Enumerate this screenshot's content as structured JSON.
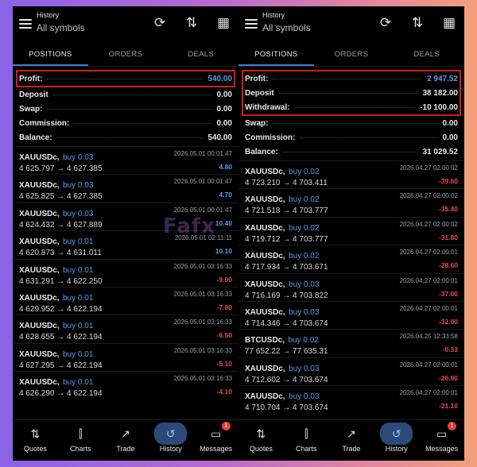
{
  "left": {
    "header": {
      "small": "History",
      "main": "All symbols"
    },
    "tabs": [
      "POSITIONS",
      "ORDERS",
      "DEALS"
    ],
    "summary": [
      {
        "label": "Profit:",
        "value": "540.00",
        "highlight": true,
        "blue": true
      },
      {
        "label": "Deposit",
        "value": "0.00"
      },
      {
        "label": "Swap:",
        "value": "0.00"
      },
      {
        "label": "Commission:",
        "value": "0.00"
      },
      {
        "label": "Balance:",
        "value": "540.00"
      }
    ],
    "deals": [
      {
        "symbol": "XAUUSDc,",
        "side": "buy 0.03",
        "time": "2026.05.01 00:01:47",
        "prices": "4 625.797 → 4 627.385",
        "profit": "4.80",
        "dir": "pos"
      },
      {
        "symbol": "XAUUSDc,",
        "side": "buy 0.03",
        "time": "2026.05.01 00:01:47",
        "prices": "4 625.825 → 4 627.385",
        "profit": "4.70",
        "dir": "pos"
      },
      {
        "symbol": "XAUUSDc,",
        "side": "buy 0.03",
        "time": "2026.05.01 00:01:47",
        "prices": "4 624.432 → 4 627.889",
        "profit": "10.40",
        "dir": "pos"
      },
      {
        "symbol": "XAUUSDc,",
        "side": "buy 0.01",
        "time": "2026.05.01 02:11:11",
        "prices": "4 620.873 → 4 631.011",
        "profit": "10.10",
        "dir": "pos"
      },
      {
        "symbol": "XAUUSDc,",
        "side": "buy 0.01",
        "time": "2026.05.01 03:16:33",
        "prices": "4 631.291 → 4 622.250",
        "profit": "-9.00",
        "dir": "neg"
      },
      {
        "symbol": "XAUUSDc,",
        "side": "buy 0.01",
        "time": "2026.05.01 03:16:33",
        "prices": "4 629.952 → 4 622.194",
        "profit": "-7.80",
        "dir": "neg"
      },
      {
        "symbol": "XAUUSDc,",
        "side": "buy 0.01",
        "time": "2026.05.01 03:16:33",
        "prices": "4 628.655 → 4 622.194",
        "profit": "-6.50",
        "dir": "neg"
      },
      {
        "symbol": "XAUUSDc,",
        "side": "buy 0.01",
        "time": "2026.05.01 03:16:33",
        "prices": "4 627.295 → 4 622.194",
        "profit": "-5.10",
        "dir": "neg"
      },
      {
        "symbol": "XAUUSDc,",
        "side": "buy 0.01",
        "time": "2026.05.01 03:16:33",
        "prices": "4 626.290 → 4 622.194",
        "profit": "-4.10",
        "dir": "neg"
      }
    ]
  },
  "right": {
    "header": {
      "small": "History",
      "main": "All symbols"
    },
    "tabs": [
      "POSITIONS",
      "ORDERS",
      "DEALS"
    ],
    "summary": [
      {
        "label": "Profit:",
        "value": "2 947.52",
        "highlight": true,
        "blue": true
      },
      {
        "label": "Deposit",
        "value": "38 182.00",
        "highlight": true
      },
      {
        "label": "Withdrawal:",
        "value": "-10 100.00",
        "highlight": true
      },
      {
        "label": "Swap:",
        "value": "0.00"
      },
      {
        "label": "Commission:",
        "value": "0.00"
      },
      {
        "label": "Balance:",
        "value": "31 029.52"
      }
    ],
    "deals": [
      {
        "symbol": "XAUUSDc,",
        "side": "buy 0.02",
        "time": "2026.04.27 02:00:02",
        "prices": "4 723.210 → 4 703.411",
        "profit": "-39.60",
        "dir": "neg"
      },
      {
        "symbol": "XAUUSDc,",
        "side": "buy 0.02",
        "time": "2026.04.27 02:00:02",
        "prices": "4 721.518 → 4 703.777",
        "profit": "-35.40",
        "dir": "neg"
      },
      {
        "symbol": "XAUUSDc,",
        "side": "buy 0.02",
        "time": "2026.04.27 02:00:02",
        "prices": "4 719.712 → 4 703.777",
        "profit": "-31.80",
        "dir": "neg"
      },
      {
        "symbol": "XAUUSDc,",
        "side": "buy 0.02",
        "time": "2026.04.27 02:00:01",
        "prices": "4 717.934 → 4 703.671",
        "profit": "-28.60",
        "dir": "neg"
      },
      {
        "symbol": "XAUUSDc,",
        "side": "buy 0.03",
        "time": "2026.04.27 02:00:01",
        "prices": "4 716.169 → 4 703.822",
        "profit": "-37.00",
        "dir": "neg"
      },
      {
        "symbol": "XAUUSDc,",
        "side": "buy 0.03",
        "time": "2026.04.27 02:00:01",
        "prices": "4 714.346 → 4 703.674",
        "profit": "-32.00",
        "dir": "neg"
      },
      {
        "symbol": "BTCUSDc,",
        "side": "buy 0.02",
        "time": "2026.04.25 12:33:58",
        "prices": "77 652.22 → 77 635.31",
        "profit": "-0.33",
        "dir": "neg"
      },
      {
        "symbol": "XAUUSDc,",
        "side": "buy 0.03",
        "time": "2026.04.27 02:00:01",
        "prices": "4 712.602 → 4 703.674",
        "profit": "-26.80",
        "dir": "neg"
      },
      {
        "symbol": "XAUUSDc,",
        "side": "buy 0.03",
        "time": "2026.04.27 02:00:01",
        "prices": "4 710.704 → 4 703.674",
        "profit": "-21.10",
        "dir": "neg"
      }
    ]
  },
  "nav": [
    {
      "label": "Quotes",
      "icon": "quotes-icon",
      "glyph": "⇅"
    },
    {
      "label": "Charts",
      "icon": "charts-icon",
      "glyph": "⫿"
    },
    {
      "label": "Trade",
      "icon": "trade-icon",
      "glyph": "↗"
    },
    {
      "label": "History",
      "icon": "history-icon",
      "glyph": "↺",
      "active": true
    },
    {
      "label": "Messages",
      "icon": "messages-icon",
      "glyph": "▭",
      "badge": "1"
    }
  ],
  "watermark": "Fafx",
  "colors": {
    "accent": "#3d7fd9",
    "positive": "#5c9be6",
    "negative": "#e05050",
    "highlight_box": "#d01c1c",
    "active_nav": "#2b4a78"
  }
}
